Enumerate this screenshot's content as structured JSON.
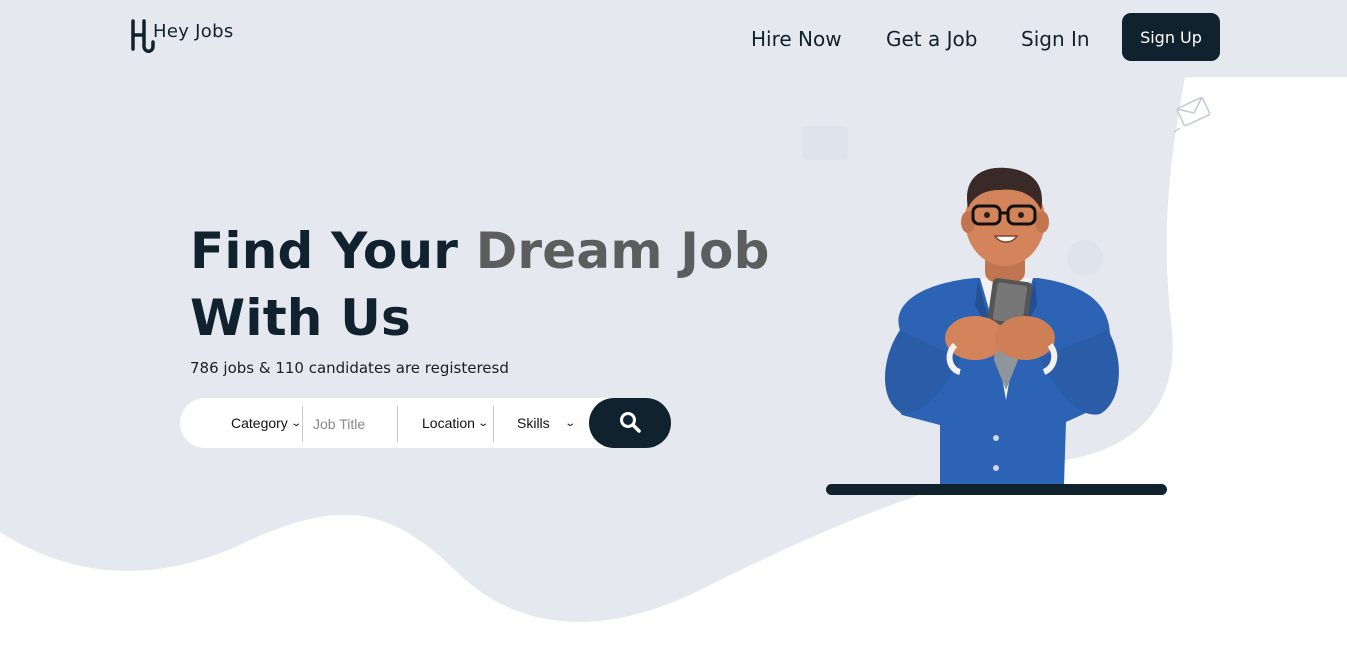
{
  "brand": {
    "name": "Hey Jobs"
  },
  "nav": {
    "hire_now": "Hire Now",
    "get_a_job": "Get a Job",
    "sign_in": "Sign In",
    "sign_up": "Sign Up"
  },
  "hero": {
    "title_part1": "Find Your ",
    "title_highlight": "Dream Job",
    "title_part2": "With Us",
    "subtitle": "786 jobs & 110 candidates are registeresd"
  },
  "search": {
    "category": "Category",
    "job_title_placeholder": "Job Title",
    "location": "Location",
    "skills": "Skills",
    "button_icon": "search-icon"
  },
  "colors": {
    "primary": "#0f222d",
    "hero_background": "#e5e8ef",
    "highlight_text": "#5d5d5d",
    "suit_blue": "#2d63b4"
  }
}
